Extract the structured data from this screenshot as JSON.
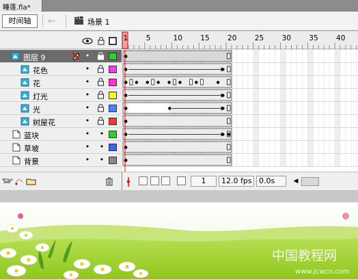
{
  "document": {
    "tab_label": "睡莲.fla*"
  },
  "edit_bar": {
    "timeline_label": "时间轴",
    "scene_label": "场景 1"
  },
  "header_icons": {
    "eye": "eye-icon",
    "lock": "lock-icon",
    "outline": "outline-square-icon"
  },
  "ruler": {
    "labels": [
      "1",
      "5",
      "10",
      "15",
      "20",
      "25",
      "30",
      "35",
      "40"
    ],
    "playhead_frame": 1
  },
  "layers": [
    {
      "name": "图层 9",
      "type": "movieclip",
      "indent": 0,
      "selected": true,
      "color": "#33cc33",
      "pencil": true
    },
    {
      "name": "花色",
      "type": "movieclip",
      "indent": 1,
      "selected": false,
      "color": "#ff33ff"
    },
    {
      "name": "花",
      "type": "movieclip",
      "indent": 1,
      "selected": false,
      "color": "#ff33cc"
    },
    {
      "name": "灯光",
      "type": "movieclip",
      "indent": 1,
      "selected": false,
      "color": "#ffff00"
    },
    {
      "name": "光",
      "type": "movieclip",
      "indent": 1,
      "selected": false,
      "color": "#4f81ff"
    },
    {
      "name": "树屋花",
      "type": "movieclip",
      "indent": 1,
      "selected": false,
      "color": "#ff3333"
    },
    {
      "name": "蓝块",
      "type": "layer",
      "indent": 0,
      "selected": false,
      "color": "#33cc33"
    },
    {
      "name": "草坡",
      "type": "layer",
      "indent": 0,
      "selected": false,
      "color": "#3366ff"
    },
    {
      "name": "背景",
      "type": "layer",
      "indent": 0,
      "selected": false,
      "color": "#888888"
    }
  ],
  "status": {
    "current_frame": "1",
    "fps": "12.0 fps",
    "elapsed": "0.0s"
  },
  "stage": {
    "watermark_main": "中国教程网",
    "watermark_url": "www.jcwcn.com"
  }
}
